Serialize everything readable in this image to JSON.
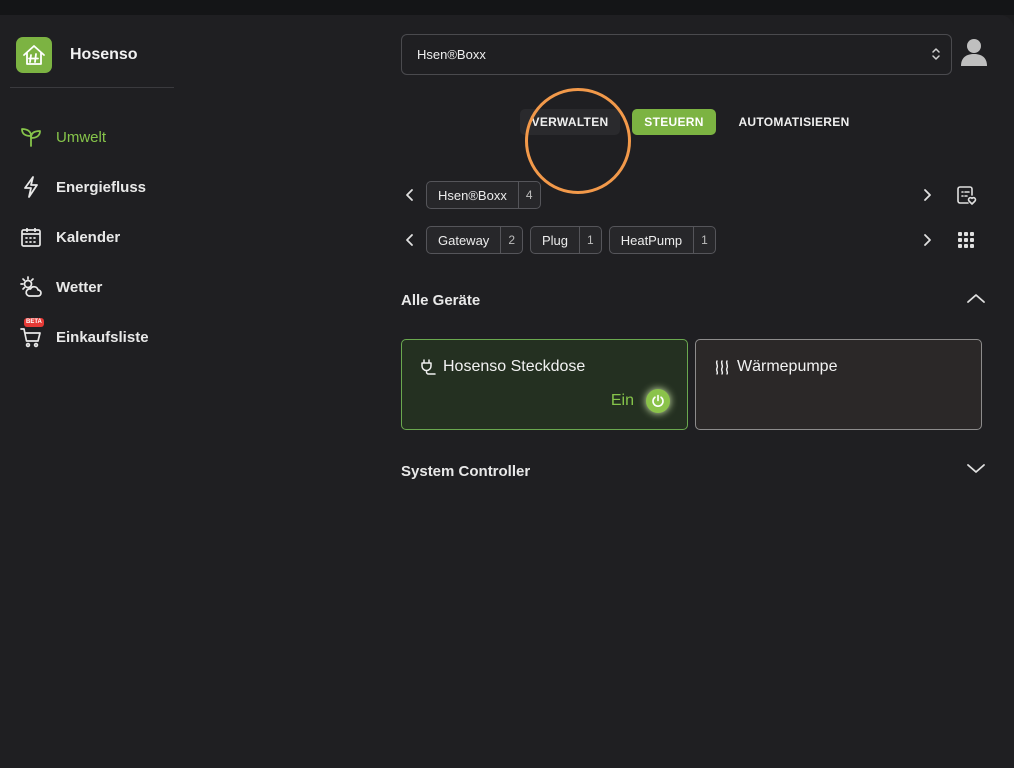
{
  "app": {
    "name": "Hosenso"
  },
  "sidebar": {
    "items": [
      {
        "label": "Umwelt",
        "icon": "sprout-icon",
        "active": true
      },
      {
        "label": "Energiefluss",
        "icon": "lightning-icon"
      },
      {
        "label": "Kalender",
        "icon": "calendar-icon"
      },
      {
        "label": "Wetter",
        "icon": "weather-icon"
      },
      {
        "label": "Einkaufsliste",
        "icon": "cart-icon",
        "badge": "BETA"
      }
    ]
  },
  "header": {
    "home_select": "Hsen®Boxx"
  },
  "modes": {
    "verwalten": "VERWALTEN",
    "steuern": "STEUERN",
    "automatisieren": "AUTOMATISIEREN",
    "active": "STEUERN"
  },
  "hubs": [
    {
      "label": "Hsen®Boxx",
      "count": "4"
    }
  ],
  "categories": [
    {
      "label": "Gateway",
      "count": "2"
    },
    {
      "label": "Plug",
      "count": "1"
    },
    {
      "label": "HeatPump",
      "count": "1"
    }
  ],
  "sections": {
    "all_devices": "Alle Geräte",
    "system_controller": "System Controller"
  },
  "devices": [
    {
      "name": "Hosenso Steckdose",
      "icon": "plug-icon",
      "state": "Ein"
    },
    {
      "name": "Wärmepumpe",
      "icon": "heat-icon"
    }
  ],
  "colors": {
    "accent": "#7cb342",
    "highlight_ring": "#f2994a",
    "background": "#1f1f22"
  }
}
